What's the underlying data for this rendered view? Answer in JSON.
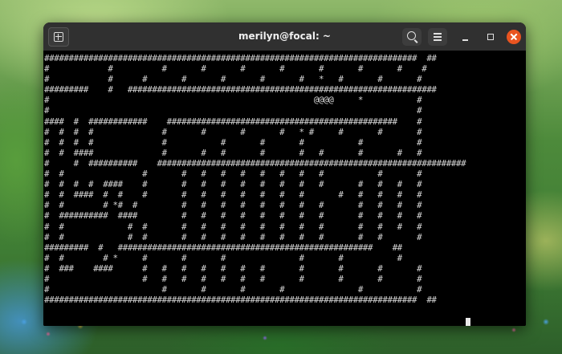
{
  "window": {
    "title": "merilyn@focal: ~"
  },
  "titlebar": {
    "icons": [
      "new-tab-icon",
      "search-icon",
      "hamburger-menu-icon",
      "minimize-icon",
      "maximize-icon",
      "close-icon"
    ]
  },
  "colors": {
    "titlebar_bg": "#303030",
    "terminal_bg": "#000000",
    "terminal_fg": "#d8d8d8",
    "close_button": "#e95420"
  },
  "terminal": {
    "output": "############################################################################  ##\n#            #          #       #       #       #       #       #       #    #\n#            #      #       #       #       #       #   *   #       #       #\n#########    #   ###############################################################\n#                                                      @@@@     *           #\n#                                                                           #\n####  #  ############    ###############################################    #\n#  #  #  #              #       #       #       #   * #     #       #       #\n#  #  #  #              #           #       #       #           #           #\n#  #  ####              #       #   #       #       #   #       #       #   #\n#     #  ##########    ###############################################################\n#  #                #       #   #   #   #   #   #   #   #           #       #\n#  #  #  #  ####    #       #   #   #   #   #   #   #   #       #   #   #   #\n#  #  ####  #  #    #       #   #   #   #   #   #   #       #   #   #   #   #\n#  #        # *#  #         #   #   #   #   #   #   #   #       #   #   #   #\n#  ##########  ####         #   #   #   #   #   #   #   #       #   #   #   #\n#  #             #  #       #   #   #   #   #   #   #   #       #   #   #   #\n#  #             #  #       #   #   #   #   #   #   #   #       #   #       #\n#########  #   ####################################################    ##\n#  #        # *     #       #       #               #       #           #\n#  ###    ####      #   #   #   #   #   #   #       #       #       #       #\n#                   #   #   #   #   #   #   #       #       #       #       #\n#                       #       #       #       #               #           #\n############################################################################  ##"
  }
}
